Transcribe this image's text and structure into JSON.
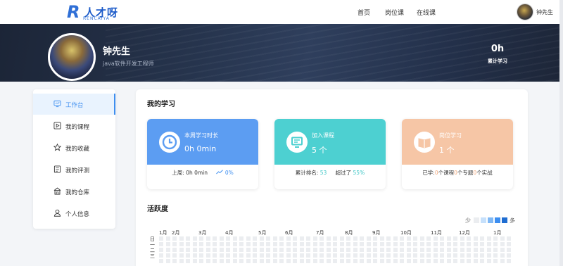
{
  "header": {
    "logo": {
      "mark": "R",
      "name": "人才呀",
      "sub": "RENCAIYA"
    },
    "nav": [
      {
        "label": "首页"
      },
      {
        "label": "岗位课"
      },
      {
        "label": "在线课"
      }
    ],
    "user_name": "钟先生"
  },
  "profile": {
    "name": "钟先生",
    "title": "java软件开发工程师",
    "study_hours": "0h",
    "study_hours_label": "累计学习"
  },
  "sidebar": {
    "items": [
      {
        "label": "工作台",
        "icon": "monitor-icon",
        "active": true
      },
      {
        "label": "我的课程",
        "icon": "play-icon"
      },
      {
        "label": "我的收藏",
        "icon": "star-icon"
      },
      {
        "label": "我的评测",
        "icon": "exam-icon"
      },
      {
        "label": "我的仓库",
        "icon": "warehouse-icon"
      },
      {
        "label": "个人信息",
        "icon": "user-icon"
      }
    ]
  },
  "main": {
    "my_learning_title": "我的学习",
    "cards": [
      {
        "label": "本周学习时长",
        "value": "0h  0min",
        "icon": "clock-icon",
        "color": "#5c9df2",
        "bottom": {
          "prefix": "上周:  0h  0min",
          "trend": "0%"
        }
      },
      {
        "label": "加入课程",
        "value": "5 个",
        "icon": "screen-icon",
        "color": "#4dd0d1",
        "bottom": {
          "rank_label": "累计排名:",
          "rank_value": "53",
          "beat_label": "超过了",
          "beat_value": "55%"
        }
      },
      {
        "label": "岗位学习",
        "value": "1 个",
        "icon": "book-icon",
        "color": "#f6c6a6",
        "bottom": {
          "learned": "已学:",
          "n1": "0",
          "t1": "个课程",
          "n2": "0",
          "t2": "个专题",
          "n3": "0",
          "t3": "个实战"
        }
      }
    ],
    "activity_title": "活跃度",
    "legend": {
      "less": "少",
      "more": "多",
      "colors": [
        "#ebedf0",
        "#c6e0fb",
        "#7fb8f5",
        "#3d8ef0",
        "#1f6dd1"
      ]
    },
    "months": [
      "1月",
      "2月",
      "3月",
      "4月",
      "5月",
      "6月",
      "7月",
      "8月",
      "9月",
      "10月",
      "11月",
      "12月",
      "1月"
    ],
    "days": [
      "日",
      "一",
      "二",
      "三"
    ]
  }
}
